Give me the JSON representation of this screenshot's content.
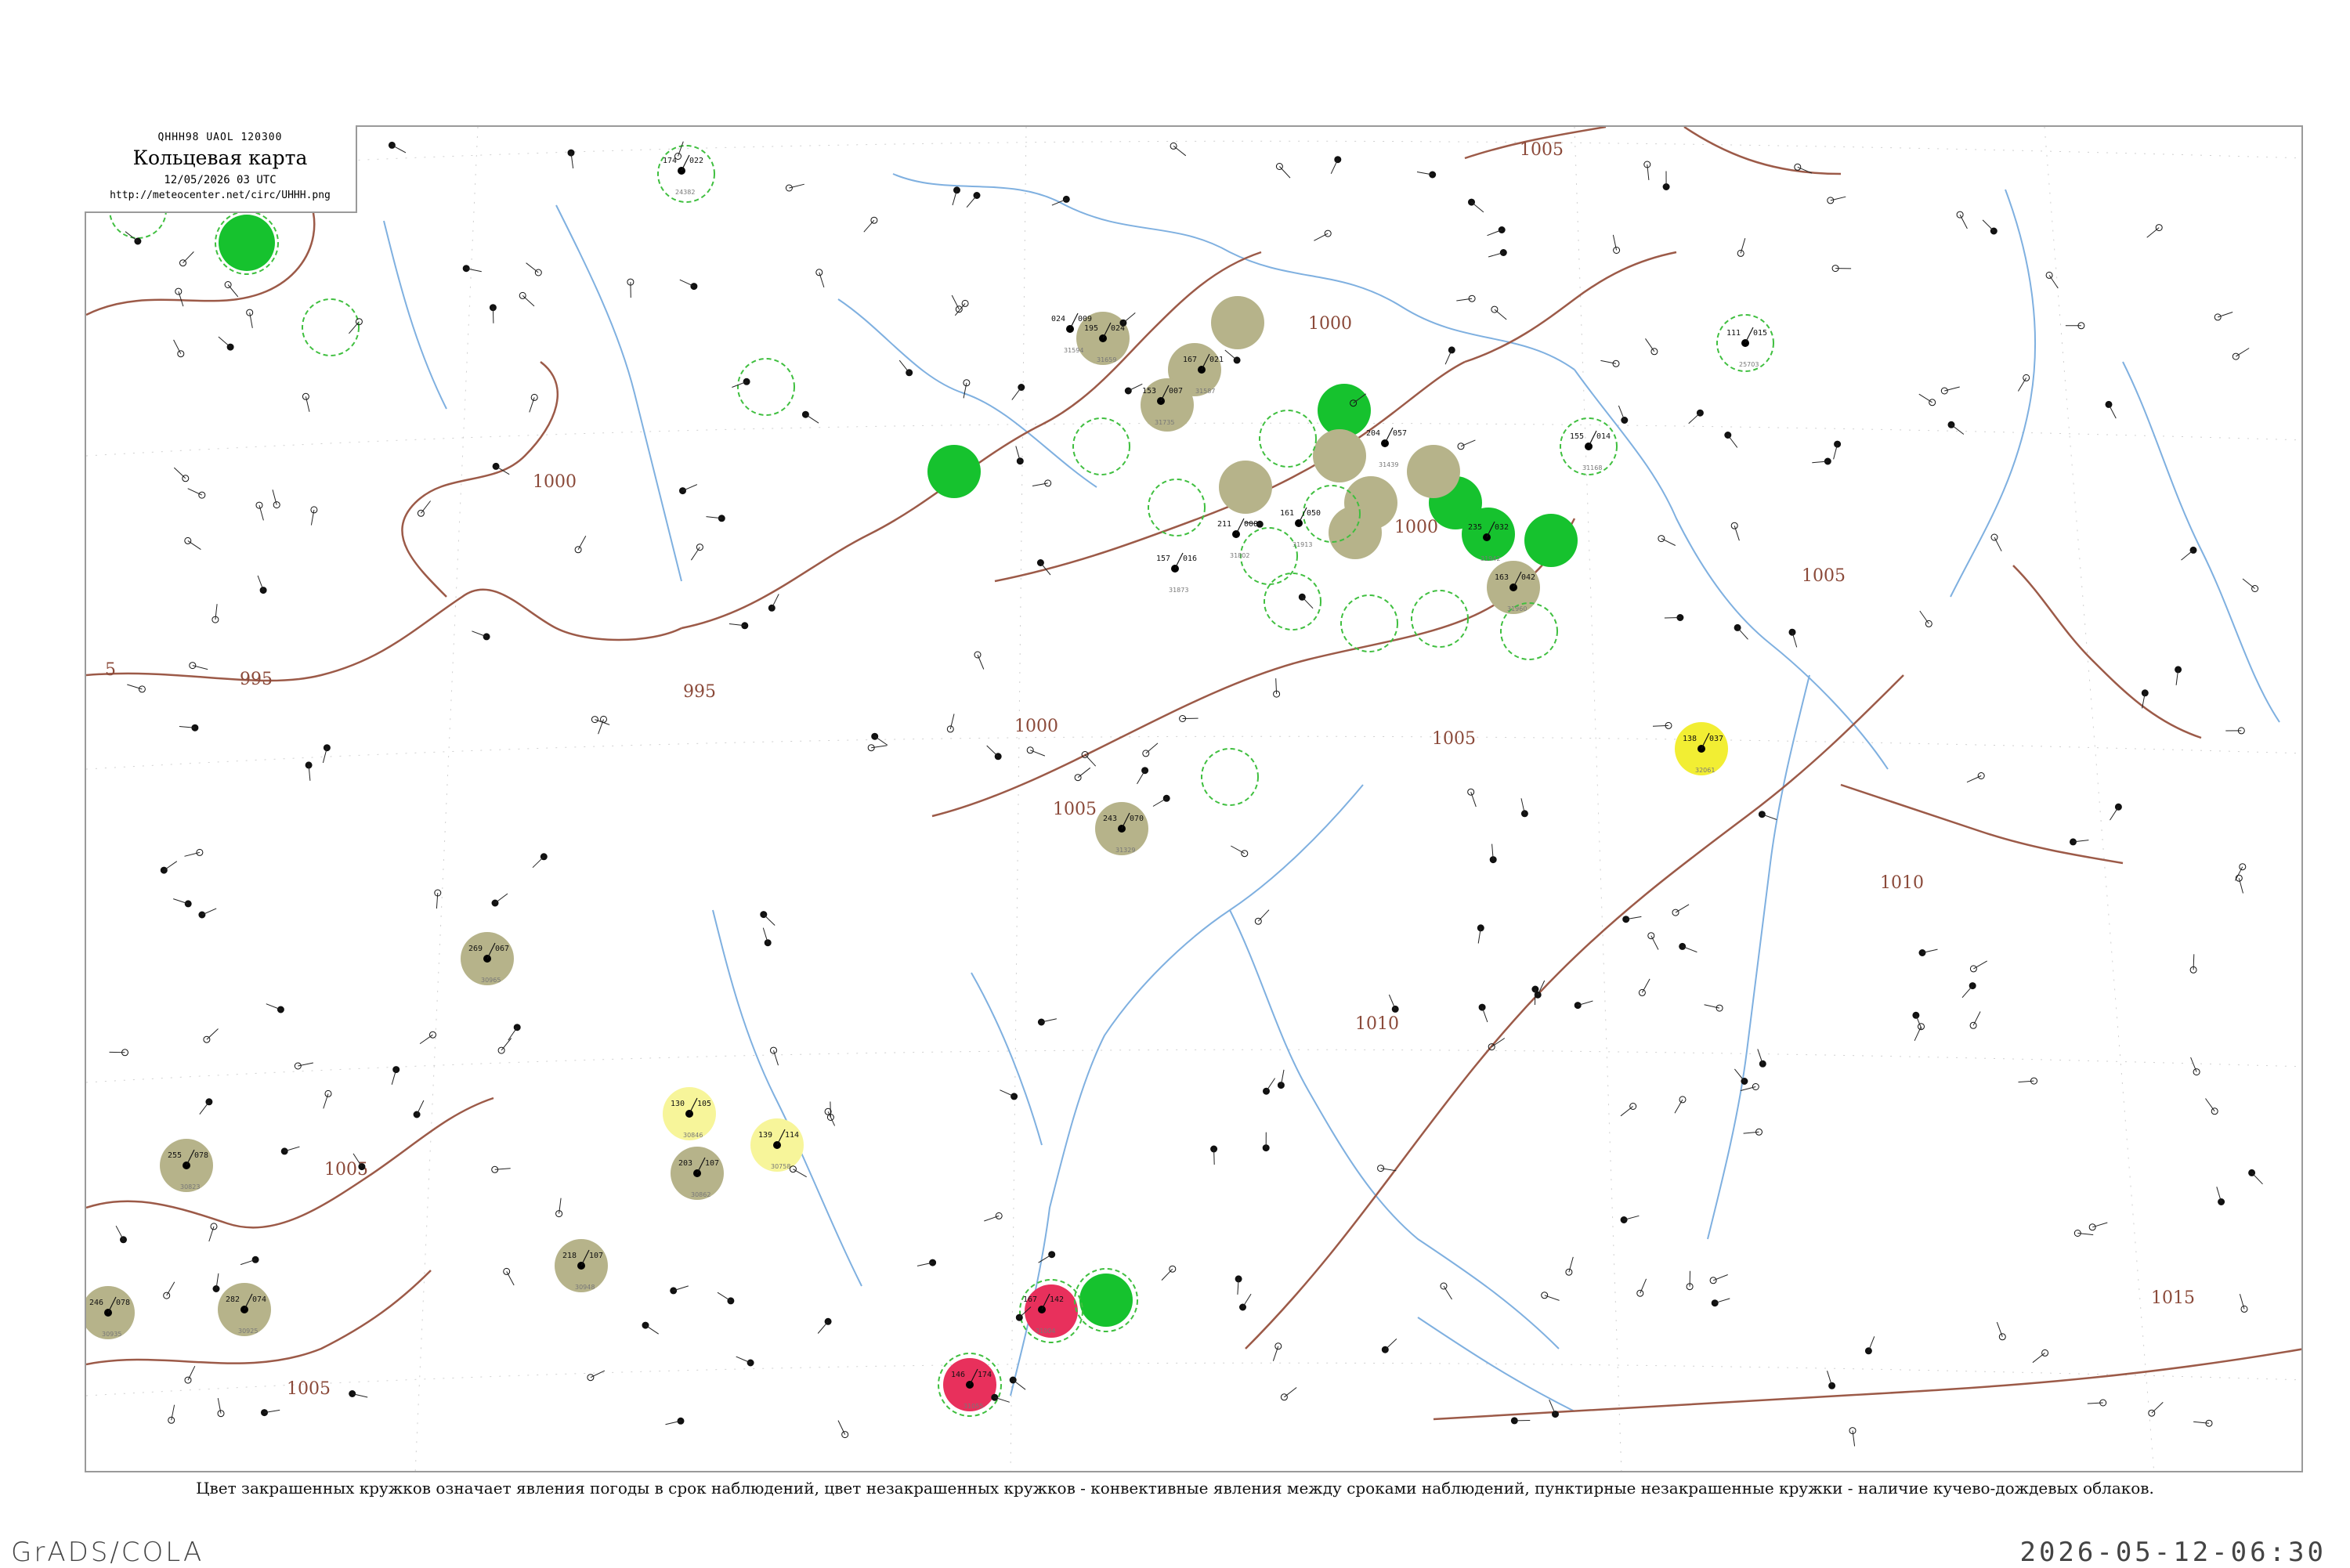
{
  "header": {
    "bulletin": "QHHH98  UAOL  120300",
    "title": "Кольцевая карта",
    "time": "12/05/2026 03 UTC",
    "url": "http://meteocenter.net/circ/UHHH.png"
  },
  "legend": {
    "caption": "Цвет закрашенных кружков означает явления погоды в срок наблюдений, цвет незакрашенных кружков - конвективные явления между сроками наблюдений, пунктирные незакрашенные кружки - наличие кучево-дождевых облаков."
  },
  "footer": {
    "software": "GrADS/COLA",
    "timestamp": "2026-05-12-06:30"
  },
  "colors": {
    "isobar": "#9c5a48",
    "river": "#7fb0e0",
    "rain_green": "#16c22e",
    "fog_olive": "#b6b38a",
    "drizzle_yellow": "#f2ee33",
    "storm_red": "#e8305c",
    "cb_dash": "#3fbf3f",
    "frame": "#9a9a9a"
  },
  "isobars": [
    {
      "label": "1005"
    },
    {
      "label": "1000"
    },
    {
      "label": "995"
    },
    {
      "label": "5"
    },
    {
      "label": "1010"
    },
    {
      "label": "1015"
    }
  ],
  "stations": [
    {
      "t": "024",
      "p": "009",
      "idx": "31594"
    },
    {
      "t": "195",
      "p": "024",
      "idx": "31659"
    },
    {
      "t": "153",
      "p": "007",
      "idx": "31735"
    },
    {
      "t": "167",
      "p": "021",
      "idx": "31587"
    },
    {
      "t": "211",
      "p": "008",
      "idx": "31802"
    },
    {
      "t": "157",
      "p": "016",
      "idx": "31873"
    },
    {
      "t": "161",
      "p": "050",
      "idx": "31913"
    },
    {
      "t": "235",
      "p": "032",
      "idx": "31942"
    },
    {
      "t": "163",
      "p": "042",
      "idx": "31960"
    },
    {
      "t": "138",
      "p": "037",
      "idx": "32061"
    },
    {
      "t": "243",
      "p": "070",
      "idx": "31329"
    },
    {
      "t": "269",
      "p": "067",
      "idx": "30965"
    },
    {
      "t": "130",
      "p": "105",
      "idx": "30846"
    },
    {
      "t": "139",
      "p": "114",
      "idx": "30758"
    },
    {
      "t": "203",
      "p": "107",
      "idx": "30862"
    },
    {
      "t": "218",
      "p": "107",
      "idx": "30948"
    },
    {
      "t": "255",
      "p": "078",
      "idx": "30823"
    },
    {
      "t": "246",
      "p": "078",
      "idx": "30935"
    },
    {
      "t": "282",
      "p": "074",
      "idx": "30925"
    },
    {
      "t": "167",
      "p": "142",
      "idx": "31004"
    },
    {
      "t": "146",
      "p": "174",
      "idx": "31055"
    },
    {
      "t": "174",
      "p": "022",
      "idx": "24382"
    },
    {
      "t": "111",
      "p": "015",
      "idx": "25703"
    },
    {
      "t": "155",
      "p": "014",
      "idx": "31168"
    },
    {
      "t": "204",
      "p": "057",
      "idx": "31439"
    }
  ]
}
